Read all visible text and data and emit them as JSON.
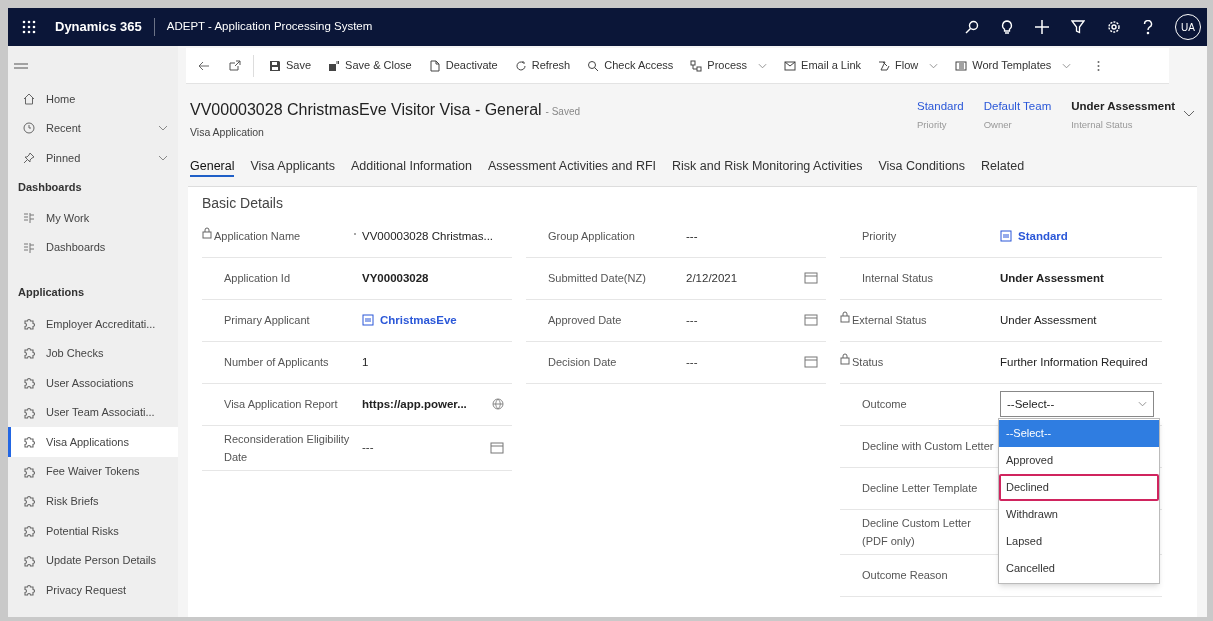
{
  "top_bar": {
    "app_name": "Dynamics 365",
    "title": "ADEPT - Application Processing System",
    "avatar": "UA"
  },
  "sidebar": {
    "items": [
      {
        "kind": "nav",
        "label": "Home",
        "expandable": false,
        "selected": false
      },
      {
        "kind": "nav",
        "label": "Recent",
        "expandable": true,
        "selected": false
      },
      {
        "kind": "nav",
        "label": "Pinned",
        "expandable": true,
        "selected": false
      },
      {
        "kind": "heading",
        "label": "Dashboards"
      },
      {
        "kind": "nav",
        "label": "My Work",
        "expandable": false,
        "selected": false
      },
      {
        "kind": "nav",
        "label": "Dashboards",
        "expandable": false,
        "selected": false
      },
      {
        "kind": "heading",
        "label": "Applications"
      },
      {
        "kind": "nav",
        "label": "Employer Accreditati...",
        "expandable": false,
        "selected": false
      },
      {
        "kind": "nav",
        "label": "Job Checks",
        "expandable": false,
        "selected": false
      },
      {
        "kind": "nav",
        "label": "User Associations",
        "expandable": false,
        "selected": false
      },
      {
        "kind": "nav",
        "label": "User Team Associati...",
        "expandable": false,
        "selected": false
      },
      {
        "kind": "nav",
        "label": "Visa Applications",
        "expandable": false,
        "selected": true
      },
      {
        "kind": "nav",
        "label": "Fee Waiver Tokens",
        "expandable": false,
        "selected": false
      },
      {
        "kind": "nav",
        "label": "Risk Briefs",
        "expandable": false,
        "selected": false
      },
      {
        "kind": "nav",
        "label": "Potential Risks",
        "expandable": false,
        "selected": false
      },
      {
        "kind": "nav",
        "label": "Update Person Details",
        "expandable": false,
        "selected": false
      },
      {
        "kind": "nav",
        "label": "Privacy Request",
        "expandable": false,
        "selected": false
      }
    ]
  },
  "command_bar": [
    {
      "label": "Save",
      "dropdown": false
    },
    {
      "label": "Save & Close",
      "dropdown": false
    },
    {
      "label": "Deactivate",
      "dropdown": false
    },
    {
      "label": "Refresh",
      "dropdown": false
    },
    {
      "label": "Check Access",
      "dropdown": false
    },
    {
      "label": "Process",
      "dropdown": true
    },
    {
      "label": "Email a Link",
      "dropdown": false
    },
    {
      "label": "Flow",
      "dropdown": true
    },
    {
      "label": "Word Templates",
      "dropdown": true
    }
  ],
  "header": {
    "title": "VV00003028 ChristmasEve Visitor Visa - General",
    "save_state": "- Saved",
    "entity": "Visa Application",
    "fields": [
      {
        "value": "Standard",
        "label": "Priority",
        "link": true
      },
      {
        "value": "Default Team",
        "label": "Owner",
        "link": true
      },
      {
        "value": "Under Assessment",
        "label": "Internal Status",
        "link": false
      }
    ]
  },
  "tabs": [
    {
      "label": "General",
      "selected": true
    },
    {
      "label": "Visa Applicants",
      "selected": false
    },
    {
      "label": "Additional Information",
      "selected": false
    },
    {
      "label": "Assessment Activities and RFI",
      "selected": false
    },
    {
      "label": "Risk and Risk Monitoring Activities",
      "selected": false
    },
    {
      "label": "Visa Conditions",
      "selected": false
    },
    {
      "label": "Related",
      "selected": false
    }
  ],
  "section": {
    "title": "Basic Details",
    "columns": [
      [
        {
          "label": "Application Name",
          "value": "VV00003028 Christmas...",
          "kind": "text",
          "locked": true,
          "required": true
        },
        {
          "label": "Application Id",
          "value": "VY00003028",
          "kind": "bold",
          "locked": false,
          "required": false
        },
        {
          "label": "Primary Applicant",
          "value": "ChristmasEve",
          "kind": "lookup",
          "locked": false,
          "required": false
        },
        {
          "label": "Number of Applicants",
          "value": "1",
          "kind": "text",
          "locked": false,
          "required": false
        },
        {
          "label": "Visa Application Report",
          "value": "https://app.power...",
          "kind": "url",
          "locked": false,
          "required": false
        },
        {
          "label": "Reconsideration Eligibility Date",
          "value": "---",
          "kind": "date",
          "locked": false,
          "required": false
        }
      ],
      [
        {
          "label": "Group Application",
          "value": "---",
          "kind": "text",
          "locked": false,
          "required": false
        },
        {
          "label": "Submitted Date(NZ)",
          "value": "2/12/2021",
          "kind": "date",
          "locked": false,
          "required": false
        },
        {
          "label": "Approved Date",
          "value": "---",
          "kind": "date",
          "locked": false,
          "required": false
        },
        {
          "label": "Decision Date",
          "value": "---",
          "kind": "date",
          "locked": false,
          "required": false
        }
      ],
      [
        {
          "label": "Priority",
          "value": "Standard",
          "kind": "lookup",
          "locked": false,
          "required": false
        },
        {
          "label": "Internal Status",
          "value": "Under Assessment",
          "kind": "bold",
          "locked": false,
          "required": false
        },
        {
          "label": "External Status",
          "value": "Under Assessment",
          "kind": "text",
          "locked": true,
          "required": false
        },
        {
          "label": "Status",
          "value": "Further Information Required",
          "kind": "text",
          "locked": true,
          "required": false
        },
        {
          "label": "Outcome",
          "value": "--Select--",
          "kind": "select",
          "locked": false,
          "required": false
        },
        {
          "label": "Decline with Custom Letter",
          "kind": "empty",
          "locked": false,
          "required": false
        },
        {
          "label": "Decline Letter Template",
          "kind": "empty",
          "locked": false,
          "required": false
        },
        {
          "label": "Decline Custom Letter (PDF only)",
          "kind": "empty",
          "locked": false,
          "required": false
        },
        {
          "label": "Outcome Reason",
          "kind": "empty",
          "locked": false,
          "required": false
        }
      ]
    ]
  },
  "outcome_dropdown": {
    "options": [
      {
        "label": "--Select--",
        "selected": true,
        "focused": false
      },
      {
        "label": "Approved",
        "selected": false,
        "focused": false
      },
      {
        "label": "Declined",
        "selected": false,
        "focused": true
      },
      {
        "label": "Withdrawn",
        "selected": false,
        "focused": false
      },
      {
        "label": "Lapsed",
        "selected": false,
        "focused": false
      },
      {
        "label": "Cancelled",
        "selected": false,
        "focused": false
      }
    ]
  }
}
